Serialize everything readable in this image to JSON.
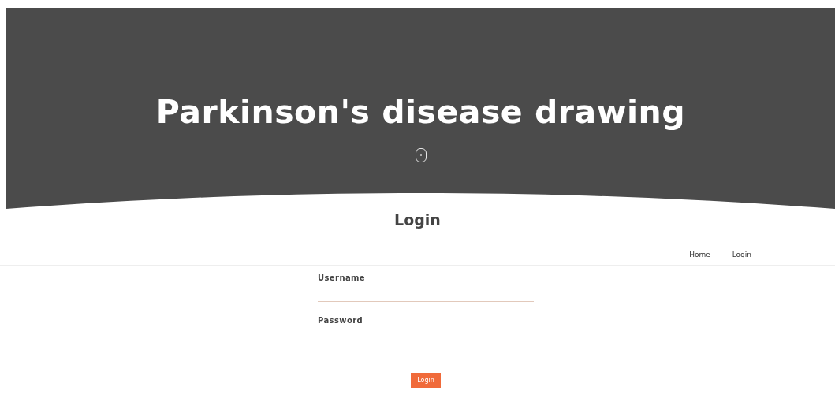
{
  "header": {
    "title": "Parkinson's disease drawing"
  },
  "section": {
    "heading": "Login"
  },
  "nav": {
    "items": [
      {
        "label": "Home"
      },
      {
        "label": "Login"
      }
    ]
  },
  "form": {
    "fields": [
      {
        "label": "Username",
        "focused": true
      },
      {
        "label": "Password",
        "focused": false
      }
    ],
    "submit": "Login"
  }
}
